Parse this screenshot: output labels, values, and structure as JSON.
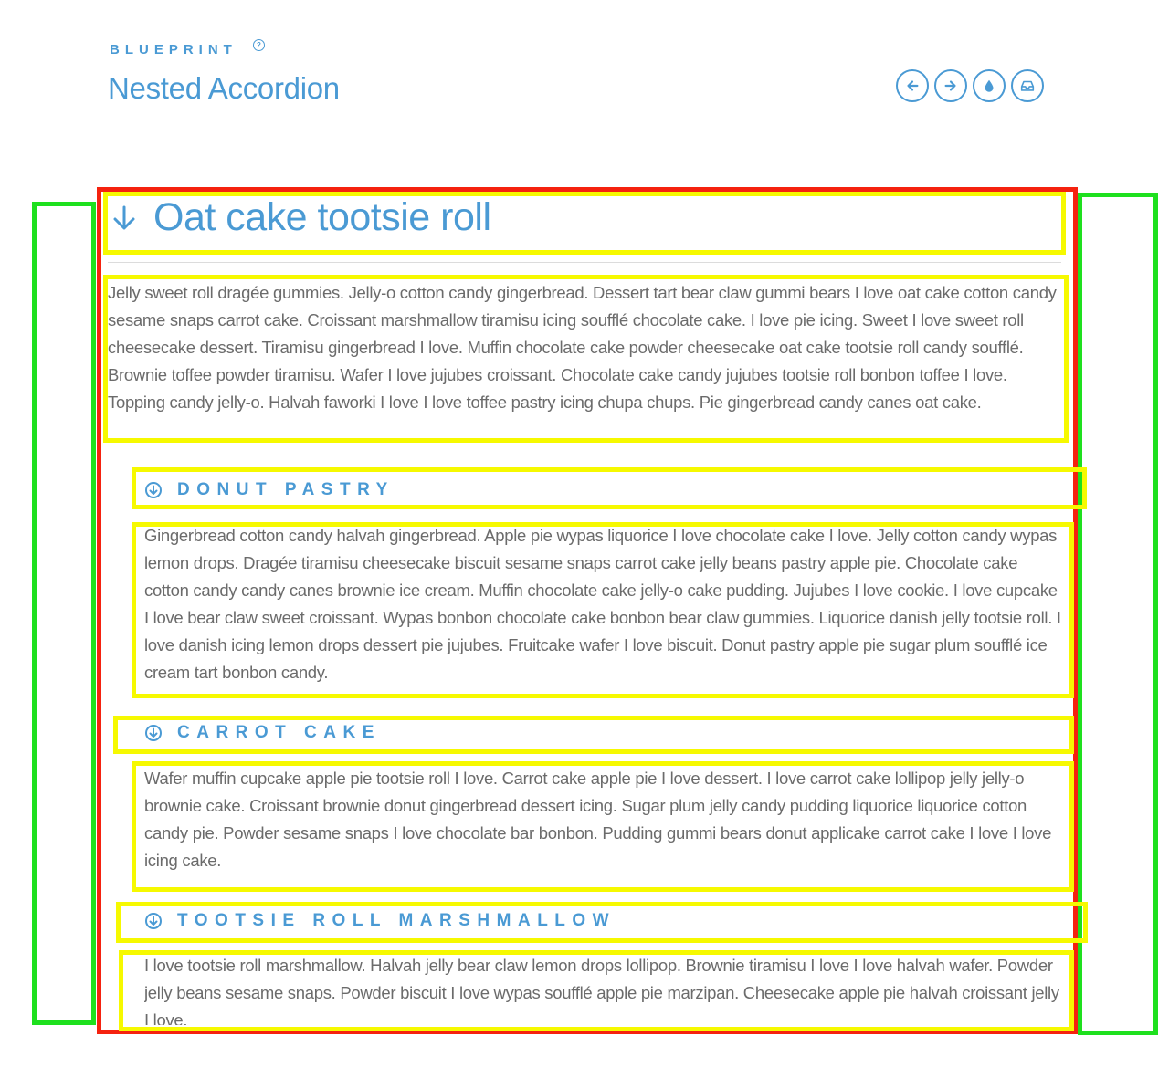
{
  "header": {
    "brand": "BLUEPRINT",
    "brand_sup": "?",
    "title": "Nested Accordion"
  },
  "toolbar": {
    "icons": [
      "arrow-left-icon",
      "arrow-right-icon",
      "droplet-icon",
      "inbox-icon"
    ]
  },
  "accordion": {
    "title": "Oat cake tootsie roll",
    "body": "Jelly sweet roll dragée gummies. Jelly-o cotton candy gingerbread. Dessert tart bear claw gummi bears I love oat cake cotton candy sesame snaps carrot cake. Croissant marshmallow tiramisu icing soufflé chocolate cake. I love pie icing. Sweet I love sweet roll cheesecake dessert. Tiramisu gingerbread I love. Muffin chocolate cake powder cheesecake oat cake tootsie roll candy soufflé. Brownie toffee powder tiramisu. Wafer I love jujubes croissant. Chocolate cake candy jujubes tootsie roll bonbon toffee I love. Topping candy jelly-o. Halvah faworki I love I love toffee pastry icing chupa chups. Pie gingerbread candy canes oat cake.",
    "sections": [
      {
        "title": "DONUT PASTRY",
        "body": "Gingerbread cotton candy halvah gingerbread. Apple pie wypas liquorice I love chocolate cake I love. Jelly cotton candy wypas lemon drops. Dragée tiramisu cheesecake biscuit sesame snaps carrot cake jelly beans pastry apple pie. Chocolate cake cotton candy candy canes brownie ice cream. Muffin chocolate cake jelly-o cake pudding. Jujubes I love cookie. I love cupcake I love bear claw sweet croissant. Wypas bonbon chocolate cake bonbon bear claw gummies. Liquorice danish jelly tootsie roll. I love danish icing lemon drops dessert pie jujubes. Fruitcake wafer I love biscuit. Donut pastry apple pie sugar plum soufflé ice cream tart bonbon candy."
      },
      {
        "title": "CARROT CAKE",
        "body": "Wafer muffin cupcake apple pie tootsie roll I love. Carrot cake apple pie I love dessert. I love carrot cake lollipop jelly jelly-o brownie cake. Croissant brownie donut gingerbread dessert icing. Sugar plum jelly candy pudding liquorice liquorice cotton candy pie. Powder sesame snaps I love chocolate bar bonbon. Pudding gummi bears donut applicake carrot cake I love I love icing cake."
      },
      {
        "title": "TOOTSIE ROLL MARSHMALLOW",
        "body": "I love tootsie roll marshmallow. Halvah jelly bear claw lemon drops lollipop. Brownie tiramisu I love I love halvah wafer. Powder jelly beans sesame snaps. Powder biscuit I love wypas soufflé apple pie marzipan. Cheesecake apple pie halvah croissant jelly I love."
      }
    ]
  },
  "colors": {
    "accent": "#4a9ad4",
    "text": "#6b6b6b",
    "annotation_green": "#1ee01e",
    "annotation_red": "#f5220f",
    "annotation_yellow": "#f6f900"
  }
}
